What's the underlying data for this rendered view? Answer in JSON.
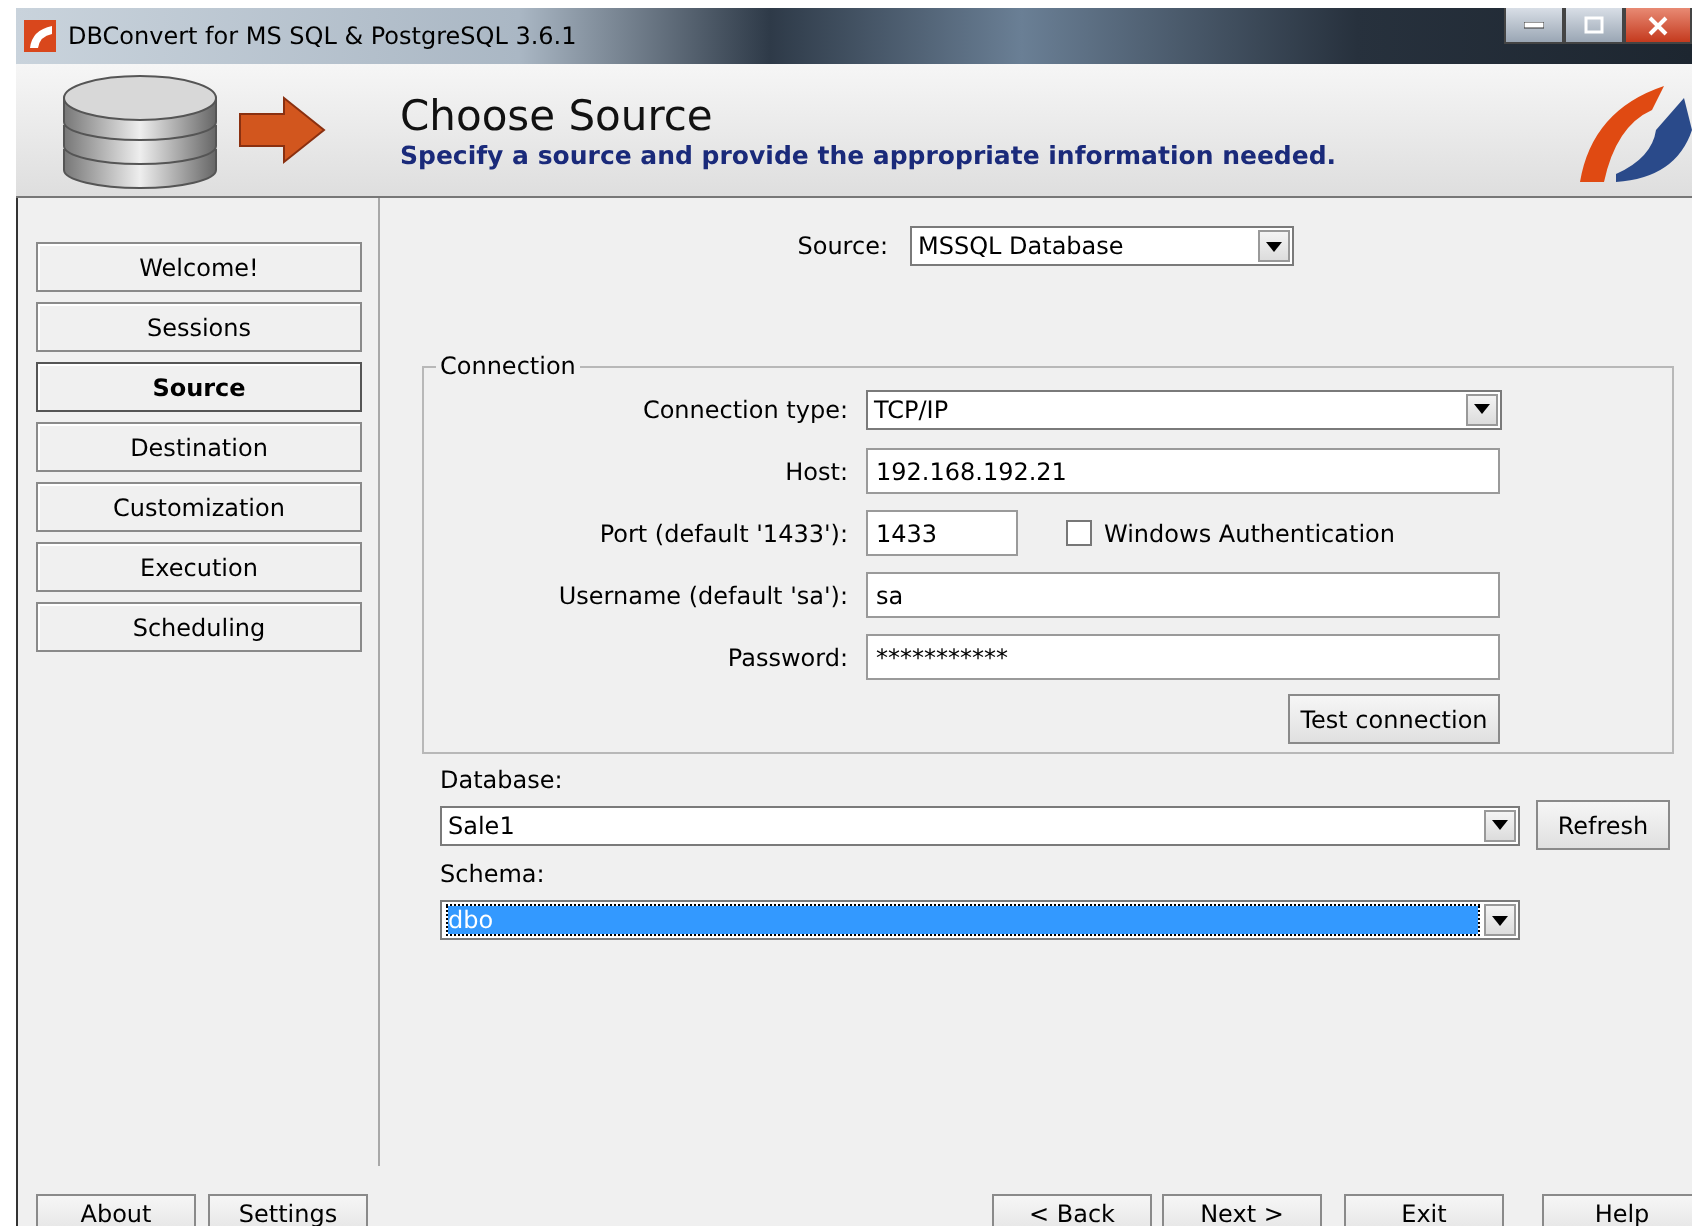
{
  "window": {
    "title": "DBConvert for MS SQL & PostgreSQL 3.6.1"
  },
  "header": {
    "title": "Choose Source",
    "subtitle": "Specify a source and provide the appropriate information needed."
  },
  "steps": [
    {
      "label": "Welcome!",
      "selected": false
    },
    {
      "label": "Sessions",
      "selected": false
    },
    {
      "label": "Source",
      "selected": true
    },
    {
      "label": "Destination",
      "selected": false
    },
    {
      "label": "Customization",
      "selected": false
    },
    {
      "label": "Execution",
      "selected": false
    },
    {
      "label": "Scheduling",
      "selected": false
    }
  ],
  "source": {
    "label": "Source:",
    "value": "MSSQL Database"
  },
  "connection": {
    "legend": "Connection",
    "connection_type": {
      "label": "Connection type:",
      "value": "TCP/IP"
    },
    "host": {
      "label": "Host:",
      "value": "192.168.192.21"
    },
    "port": {
      "label": "Port (default '1433'):",
      "value": "1433"
    },
    "windows_authentication": {
      "label": "Windows Authentication",
      "checked": false
    },
    "username": {
      "label": "Username (default 'sa'):",
      "value": "sa"
    },
    "password": {
      "label": "Password:",
      "value": "***********"
    },
    "test_button": "Test connection"
  },
  "database": {
    "label": "Database:",
    "value": "Sale1"
  },
  "refresh_button": "Refresh",
  "schema": {
    "label": "Schema:",
    "value": "dbo",
    "selected": true
  },
  "footer": {
    "left_buttons": [
      "About",
      "Settings"
    ],
    "right_buttons": [
      "< Back",
      "Next >",
      "Exit",
      "Help"
    ]
  }
}
